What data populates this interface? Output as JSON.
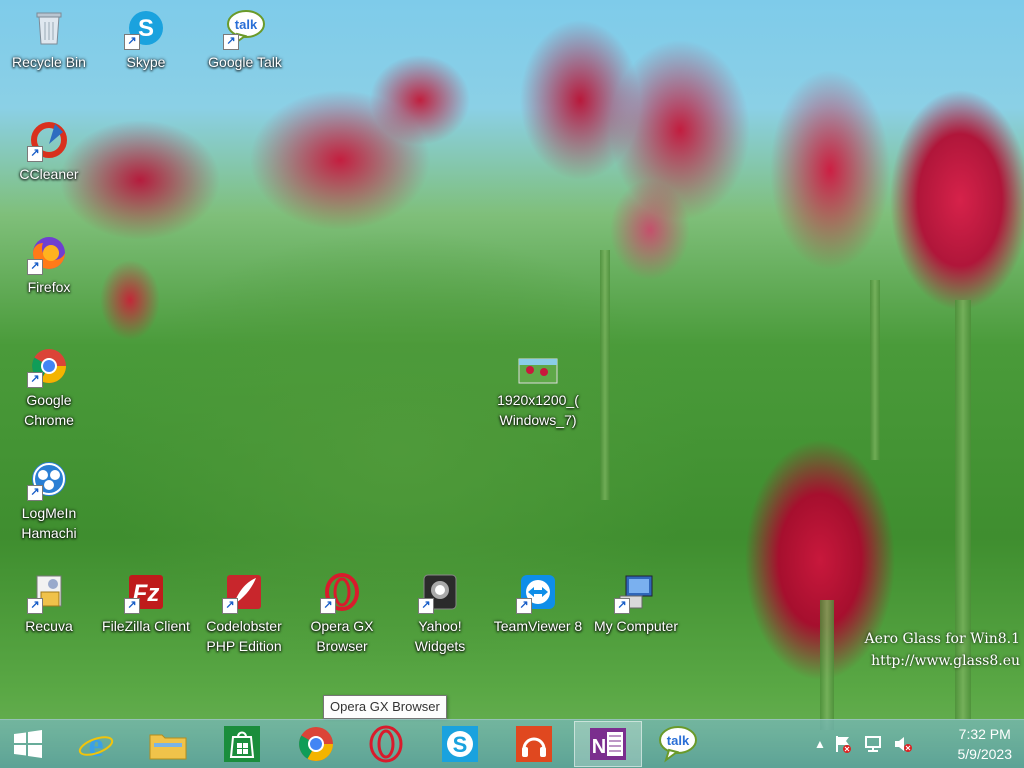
{
  "desktop": {
    "icons": [
      {
        "label": "Recycle Bin"
      },
      {
        "label": "Skype"
      },
      {
        "label": "Google Talk"
      },
      {
        "label": "CCleaner"
      },
      {
        "label": "Firefox"
      },
      {
        "label": "Google\nChrome"
      },
      {
        "label": "LogMeIn\nHamachi"
      },
      {
        "label": "Recuva"
      },
      {
        "label": "FileZilla Client"
      },
      {
        "label": "Codelobster\nPHP Edition"
      },
      {
        "label": "Opera GX\nBrowser"
      },
      {
        "label": "Yahoo!\nWidgets"
      },
      {
        "label": "TeamViewer 8"
      },
      {
        "label": "My Computer"
      },
      {
        "label": "1920x1200_(\nWindows_7)"
      }
    ],
    "watermark": {
      "line1": "Aero Glass for Win8.1",
      "line2": "http://www.glass8.eu"
    }
  },
  "tooltip": {
    "text": "Opera GX Browser"
  },
  "taskbar": {
    "pinned": [
      "start",
      "internet-explorer",
      "file-explorer",
      "store",
      "chrome",
      "opera-gx",
      "skype",
      "music",
      "onenote",
      "google-talk"
    ],
    "clock": {
      "time": "7:32 PM",
      "date": "5/9/2023"
    }
  },
  "colors": {
    "taskbar": "#5fa6a6",
    "onenote": "#7b2e8e",
    "store": "#1a8d3c",
    "skype": "#1aa2de"
  }
}
